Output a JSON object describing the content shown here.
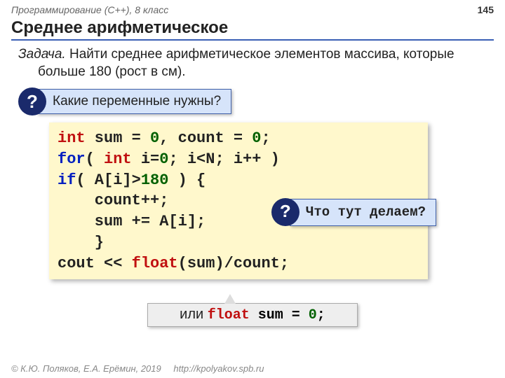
{
  "header": {
    "course": "Программирование (C++), 8 класс",
    "page": "145"
  },
  "title": "Среднее арифметическое",
  "task": {
    "label": "Задача.",
    "body": "Найти среднее арифметическое элементов массива, которые больше 180 (рост в см)."
  },
  "q1": {
    "mark": "?",
    "text": "Какие переменные нужны?"
  },
  "code": {
    "l1a": "int",
    "l1b": " sum = ",
    "l1c": "0",
    "l1d": ", count = ",
    "l1e": "0",
    "l1f": ";",
    "l2a": "for",
    "l2b": "( ",
    "l2c": "int",
    "l2d": " i=",
    "l2e": "0",
    "l2f": "; i<N; i++ )",
    "l3a": "  ",
    "l3b": "if",
    "l3c": "( A[i]>",
    "l3d": "180",
    "l3e": " ) {",
    "l4": "    count++;",
    "l5": "    sum += A[i];",
    "l6": "    }",
    "l7a": "cout << ",
    "l7b": "float",
    "l7c": "(sum)/count;"
  },
  "q2": {
    "mark": "?",
    "text": "Что тут делаем?"
  },
  "alt": {
    "or": "или ",
    "kw": "float",
    "rest": " sum = ",
    "zero": "0",
    "semi": ";"
  },
  "footer": {
    "copy": "© К.Ю. Поляков, Е.А. Ерёмин, 2019",
    "url": "http://kpolyakov.spb.ru"
  }
}
